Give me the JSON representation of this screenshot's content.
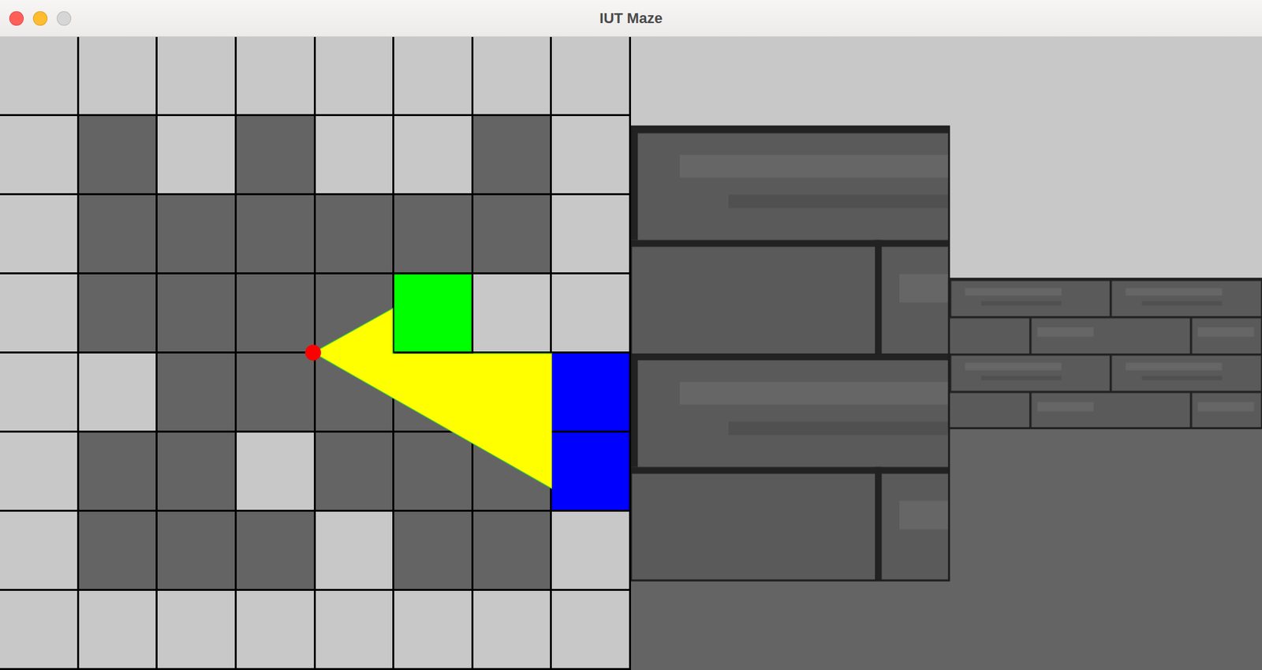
{
  "window": {
    "title": "IUT Maze",
    "controls": [
      {
        "name": "close",
        "color": "#fe5f57"
      },
      {
        "name": "minimize",
        "color": "#febc2e"
      },
      {
        "name": "zoom",
        "color": "#d6d6d6"
      }
    ]
  },
  "map": {
    "grid": [
      [
        "wall",
        "wall",
        "wall",
        "wall",
        "wall",
        "wall",
        "wall",
        "wall"
      ],
      [
        "wall",
        "floor",
        "wall",
        "floor",
        "wall",
        "wall",
        "floor",
        "wall"
      ],
      [
        "wall",
        "floor",
        "floor",
        "floor",
        "floor",
        "floor",
        "floor",
        "wall"
      ],
      [
        "wall",
        "floor",
        "floor",
        "floor",
        "floor",
        "target",
        "wall",
        "wall"
      ],
      [
        "wall",
        "wall",
        "floor",
        "floor",
        "floor",
        "floor",
        "floor",
        "hit"
      ],
      [
        "wall",
        "floor",
        "floor",
        "wall",
        "floor",
        "floor",
        "floor",
        "hit"
      ],
      [
        "wall",
        "floor",
        "floor",
        "floor",
        "wall",
        "floor",
        "floor",
        "wall"
      ],
      [
        "wall",
        "wall",
        "wall",
        "wall",
        "wall",
        "wall",
        "wall",
        "wall"
      ]
    ],
    "player": {
      "x": 3.97,
      "y": 3.99
    },
    "rays": [
      [
        3.97,
        3.99
      ],
      [
        4.98,
        3.43
      ],
      [
        4.98,
        4.0
      ],
      [
        7.0,
        4.0
      ],
      [
        7.0,
        5.71
      ]
    ]
  },
  "view": {
    "walls": [
      {
        "from": 0,
        "to": 0.504,
        "height": 0.717,
        "rows": 4
      },
      {
        "from": 0.504,
        "to": 1,
        "height": 0.236,
        "rows": 4
      }
    ]
  }
}
